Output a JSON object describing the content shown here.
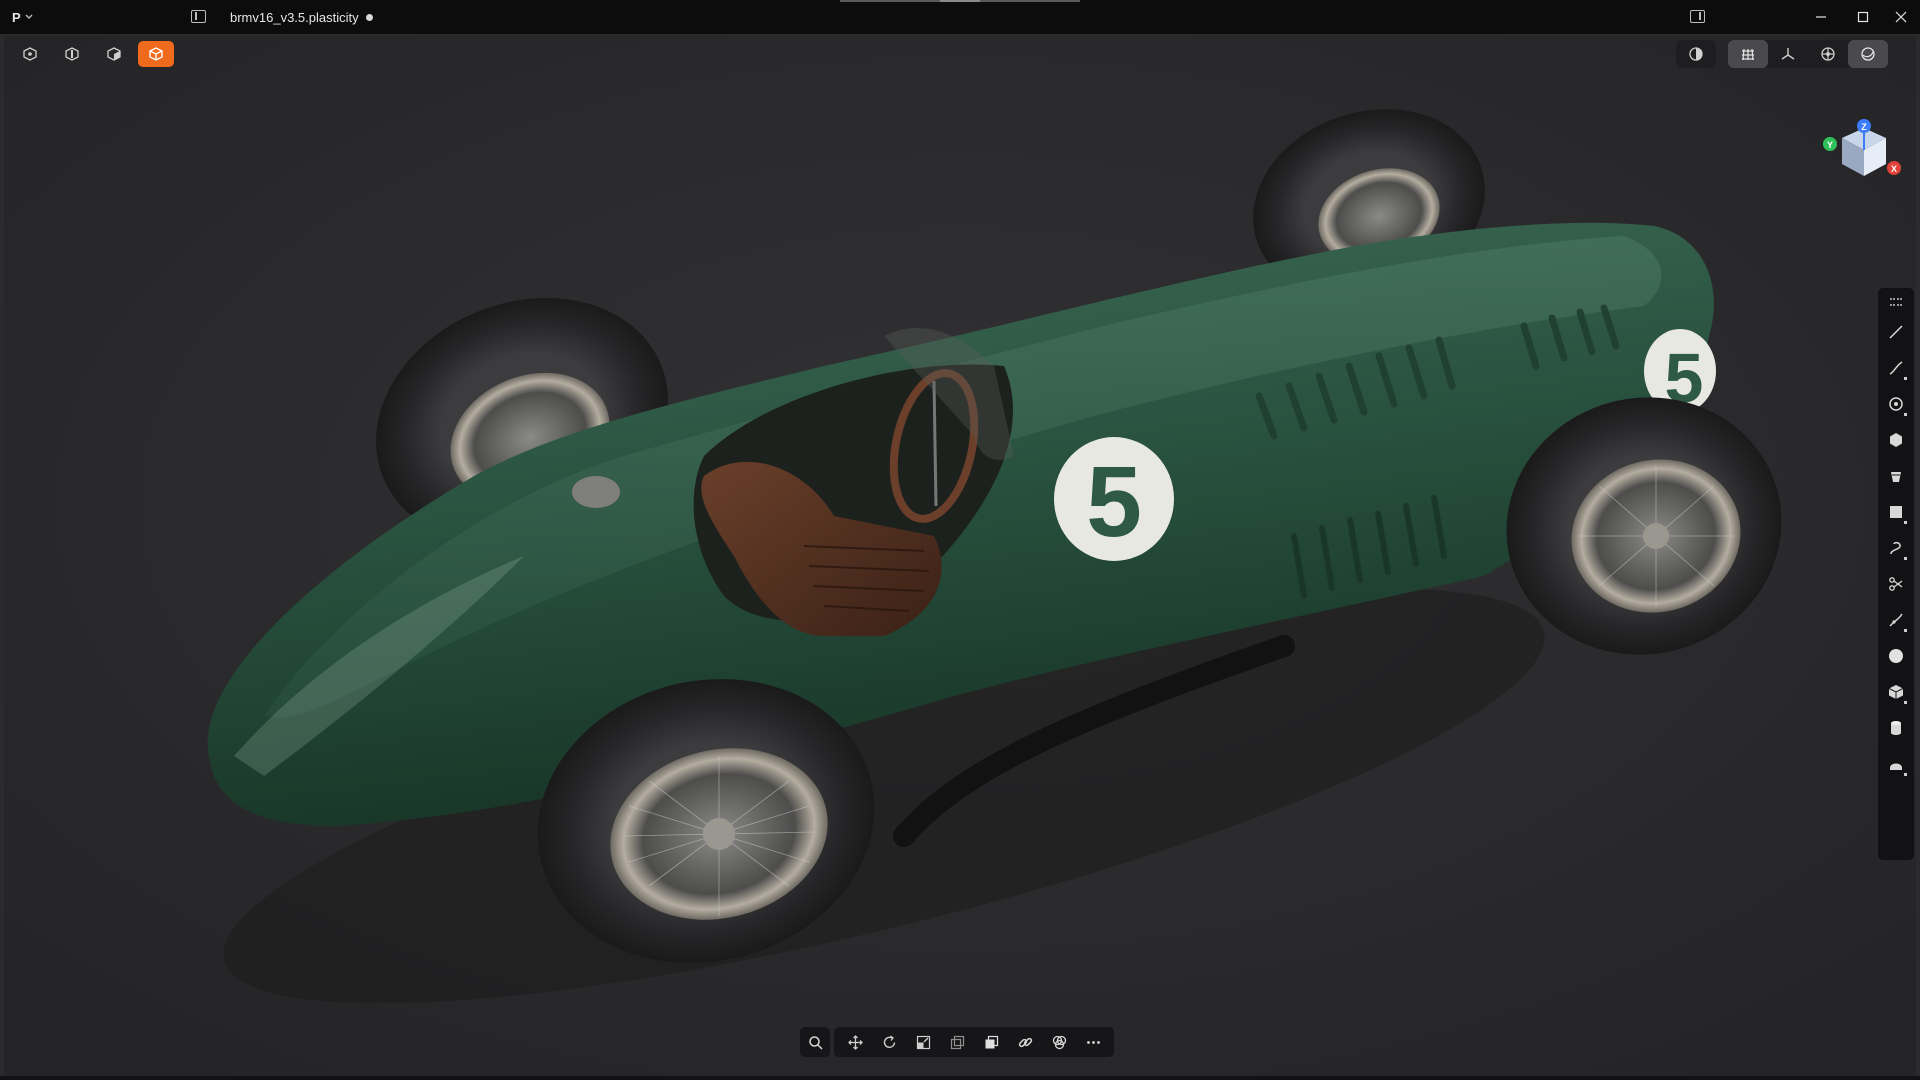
{
  "window": {
    "app_menu_label": "P",
    "file_name": "brmv16_v3.5.plasticity",
    "unsaved_indicator": true
  },
  "icons": {
    "title_bar": [
      "app-logo-icon",
      "chevron-down-icon",
      "sidebar-toggle-icon",
      "right-panel-toggle-icon",
      "minimize-icon",
      "maximize-icon",
      "close-icon"
    ],
    "selection_modes": [
      "vertex-select-icon",
      "edge-select-icon",
      "face-select-icon",
      "solid-select-icon"
    ],
    "view_options": [
      "xray-icon",
      "grid-icon",
      "axes-icon",
      "overlay-icon",
      "render-mode-icon"
    ],
    "right_toolbar": [
      "line-icon",
      "curve-icon",
      "circle-icon",
      "polygon-icon",
      "bucket-icon",
      "rectangle-icon",
      "spiral-curve-icon",
      "scissors-cut-icon",
      "fillet-icon",
      "sphere-icon",
      "box-icon",
      "cylinder-icon",
      "sweep-icon"
    ],
    "bottom_toolbar": [
      "search-icon",
      "move-icon",
      "rotate-icon",
      "scale-icon",
      "duplicate-icon",
      "boolean-icon",
      "link-icon",
      "intersect-icon",
      "more-icon"
    ]
  },
  "nav_cube": {
    "axis_x": "X",
    "axis_y": "Y",
    "axis_z": "Z"
  },
  "viewport": {
    "race_number": "5"
  },
  "colors": {
    "accent": "#f06a1e",
    "car_body": "#2f5a45",
    "background": "#2b2b2d"
  },
  "state": {
    "active_selection_mode": "solid",
    "active_view_options": [
      "grid",
      "render-mode"
    ]
  }
}
